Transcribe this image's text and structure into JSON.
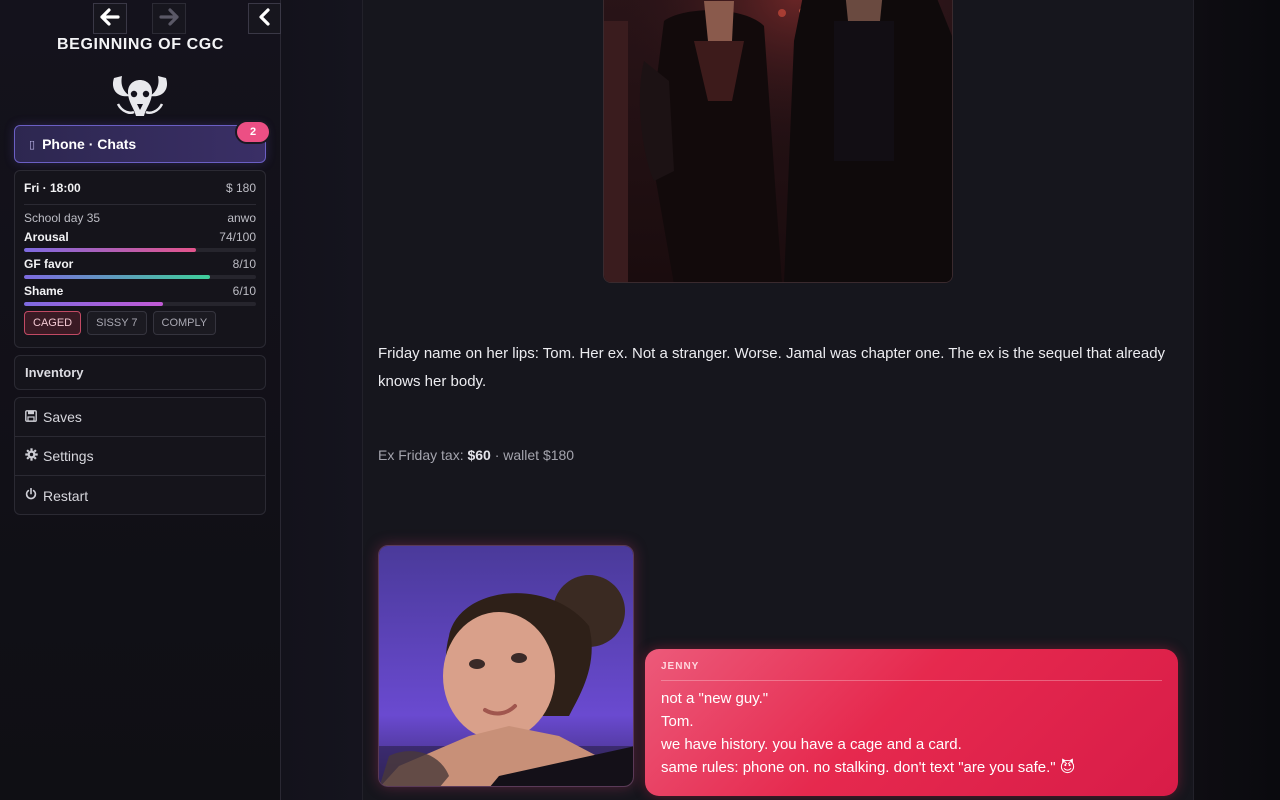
{
  "sidebar": {
    "nav": {
      "back_glyph": "🡐",
      "forward_glyph": "🡒",
      "collapse_glyph": "‹"
    },
    "story_title": "BEGINNING OF CGC",
    "phone": {
      "label": "Phone · Chats",
      "badge": "2"
    },
    "stats": {
      "day_time": "Fri · 18:00",
      "money": "$ 180",
      "school_day": "School day 35",
      "player": "anwo",
      "meters": [
        {
          "label": "Arousal",
          "value": "74/100",
          "fraction": 0.74,
          "color": "#e4548c"
        },
        {
          "label": "GF favor",
          "value": "8/10",
          "fraction": 0.8,
          "color": "#3ecf9a"
        },
        {
          "label": "Shame",
          "value": "6/10",
          "fraction": 0.6,
          "color": "#c25ad6"
        }
      ],
      "tags": [
        {
          "label": "CAGED",
          "active": true
        },
        {
          "label": "SISSY 7",
          "active": false
        },
        {
          "label": "COMPLY",
          "active": false
        }
      ]
    },
    "inventory_label": "Inventory",
    "menu": [
      {
        "icon": "save-icon",
        "glyph": "💾",
        "label": "Saves"
      },
      {
        "icon": "gear-icon",
        "glyph": "⚙",
        "label": "Settings"
      },
      {
        "icon": "power-icon",
        "glyph": "⏻",
        "label": "Restart"
      }
    ]
  },
  "main": {
    "narration": "Friday name on her lips: Tom. Her ex. Not a stranger. Worse. Jamal was chapter one. The ex is the sequel that already knows her body.",
    "tax": {
      "prefix": "Ex Friday tax: ",
      "amount": "$60",
      "suffix": " · wallet $180"
    },
    "chat": {
      "sender": "JENNY",
      "lines": [
        "not a \"new guy.\"",
        "Tom.",
        "we have history. you have a cage and a card.",
        "same rules: phone on. no stalking. don't text \"are you safe.\" 😈"
      ]
    }
  },
  "colors": {
    "accent_purple": "#6b5fc4",
    "badge_pink": "#ec4f84",
    "bubble_red": "#e6294e"
  }
}
